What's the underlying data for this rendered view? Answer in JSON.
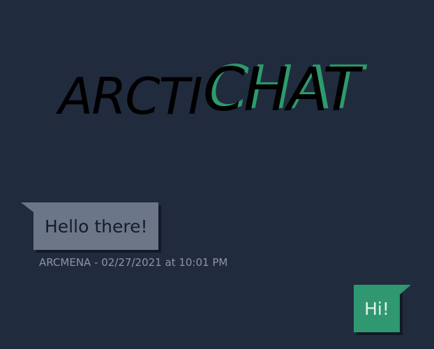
{
  "logo": {
    "part_a": "ARCTI",
    "part_b": "CHAT"
  },
  "colors": {
    "background": "#212b3e",
    "accent": "#2e9a6e",
    "incoming_bubble": "#6b7788",
    "outgoing_bubble": "#2f9870",
    "meta_text": "#8c95a4"
  },
  "messages": [
    {
      "direction": "incoming",
      "text": "Hello there!",
      "meta": "ARCMENA - 02/27/2021 at 10:01 PM"
    },
    {
      "direction": "outgoing",
      "text": "Hi!"
    }
  ]
}
